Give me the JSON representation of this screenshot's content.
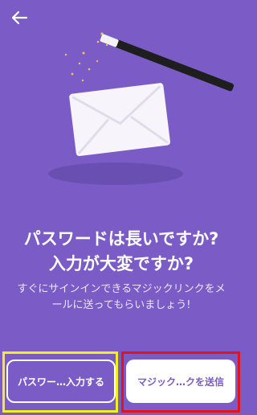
{
  "header": {
    "back_icon": "arrow-left-icon"
  },
  "illustration": {
    "description_icon": "magic-envelope-icon",
    "colors": {
      "envelope": "#f7f5fb",
      "wand": "#1e1e1e",
      "sparkle": "#f0c64a",
      "shadow": "#6a4fb2"
    }
  },
  "content": {
    "headline_line1": "パスワードは長いですか?",
    "headline_line2": "入力が大変ですか?",
    "subtext": "すぐにサインインできるマジックリンクをメールに送ってもらいましょう!"
  },
  "buttons": {
    "secondary_label": "パスワー…入力する",
    "primary_label": "マジック…クを送信"
  },
  "colors": {
    "background": "#7b5cc6",
    "highlight_yellow": "#f2ef1a",
    "highlight_red": "#e0141b"
  }
}
